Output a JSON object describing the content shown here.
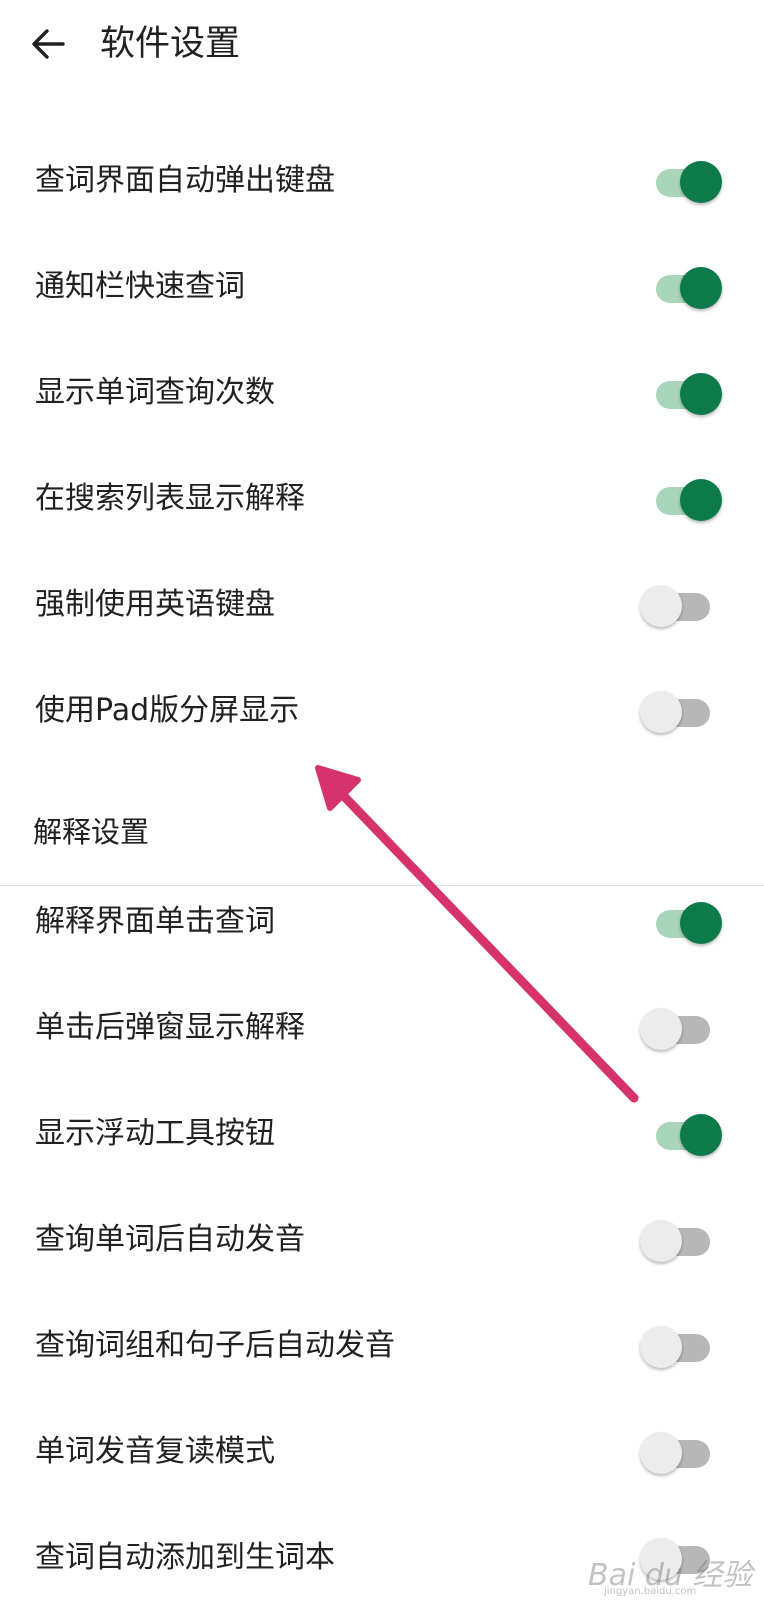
{
  "app_bar": {
    "title": "软件设置",
    "back_icon": "arrow-left-icon"
  },
  "settings": [
    {
      "label": "查词界面自动弹出键盘",
      "enabled": true
    },
    {
      "label": "通知栏快速查词",
      "enabled": true
    },
    {
      "label": "显示单词查询次数",
      "enabled": true
    },
    {
      "label": "在搜索列表显示解释",
      "enabled": true
    },
    {
      "label": "强制使用英语键盘",
      "enabled": false
    },
    {
      "label": "使用Pad版分屏显示",
      "enabled": false
    }
  ],
  "section": {
    "title": "解释设置"
  },
  "explain_settings": [
    {
      "label": "解释界面单击查词",
      "enabled": true
    },
    {
      "label": "单击后弹窗显示解释",
      "enabled": false
    },
    {
      "label": "显示浮动工具按钮",
      "enabled": true
    },
    {
      "label": "查询单词后自动发音",
      "enabled": false
    },
    {
      "label": "查询词组和句子后自动发音",
      "enabled": false
    },
    {
      "label": "单词发音复读模式",
      "enabled": false
    },
    {
      "label": "查词自动添加到生词本",
      "enabled": false
    }
  ],
  "colors": {
    "switch_on_thumb": "#0d7a4a",
    "switch_on_track": "#a9d5bb",
    "switch_off_thumb": "#ececec",
    "switch_off_track": "#b7b7b7",
    "annotation_arrow": "#d6336c"
  },
  "watermark": {
    "main": "Bai du 经验",
    "sub": "jingyan.baidu.com"
  }
}
